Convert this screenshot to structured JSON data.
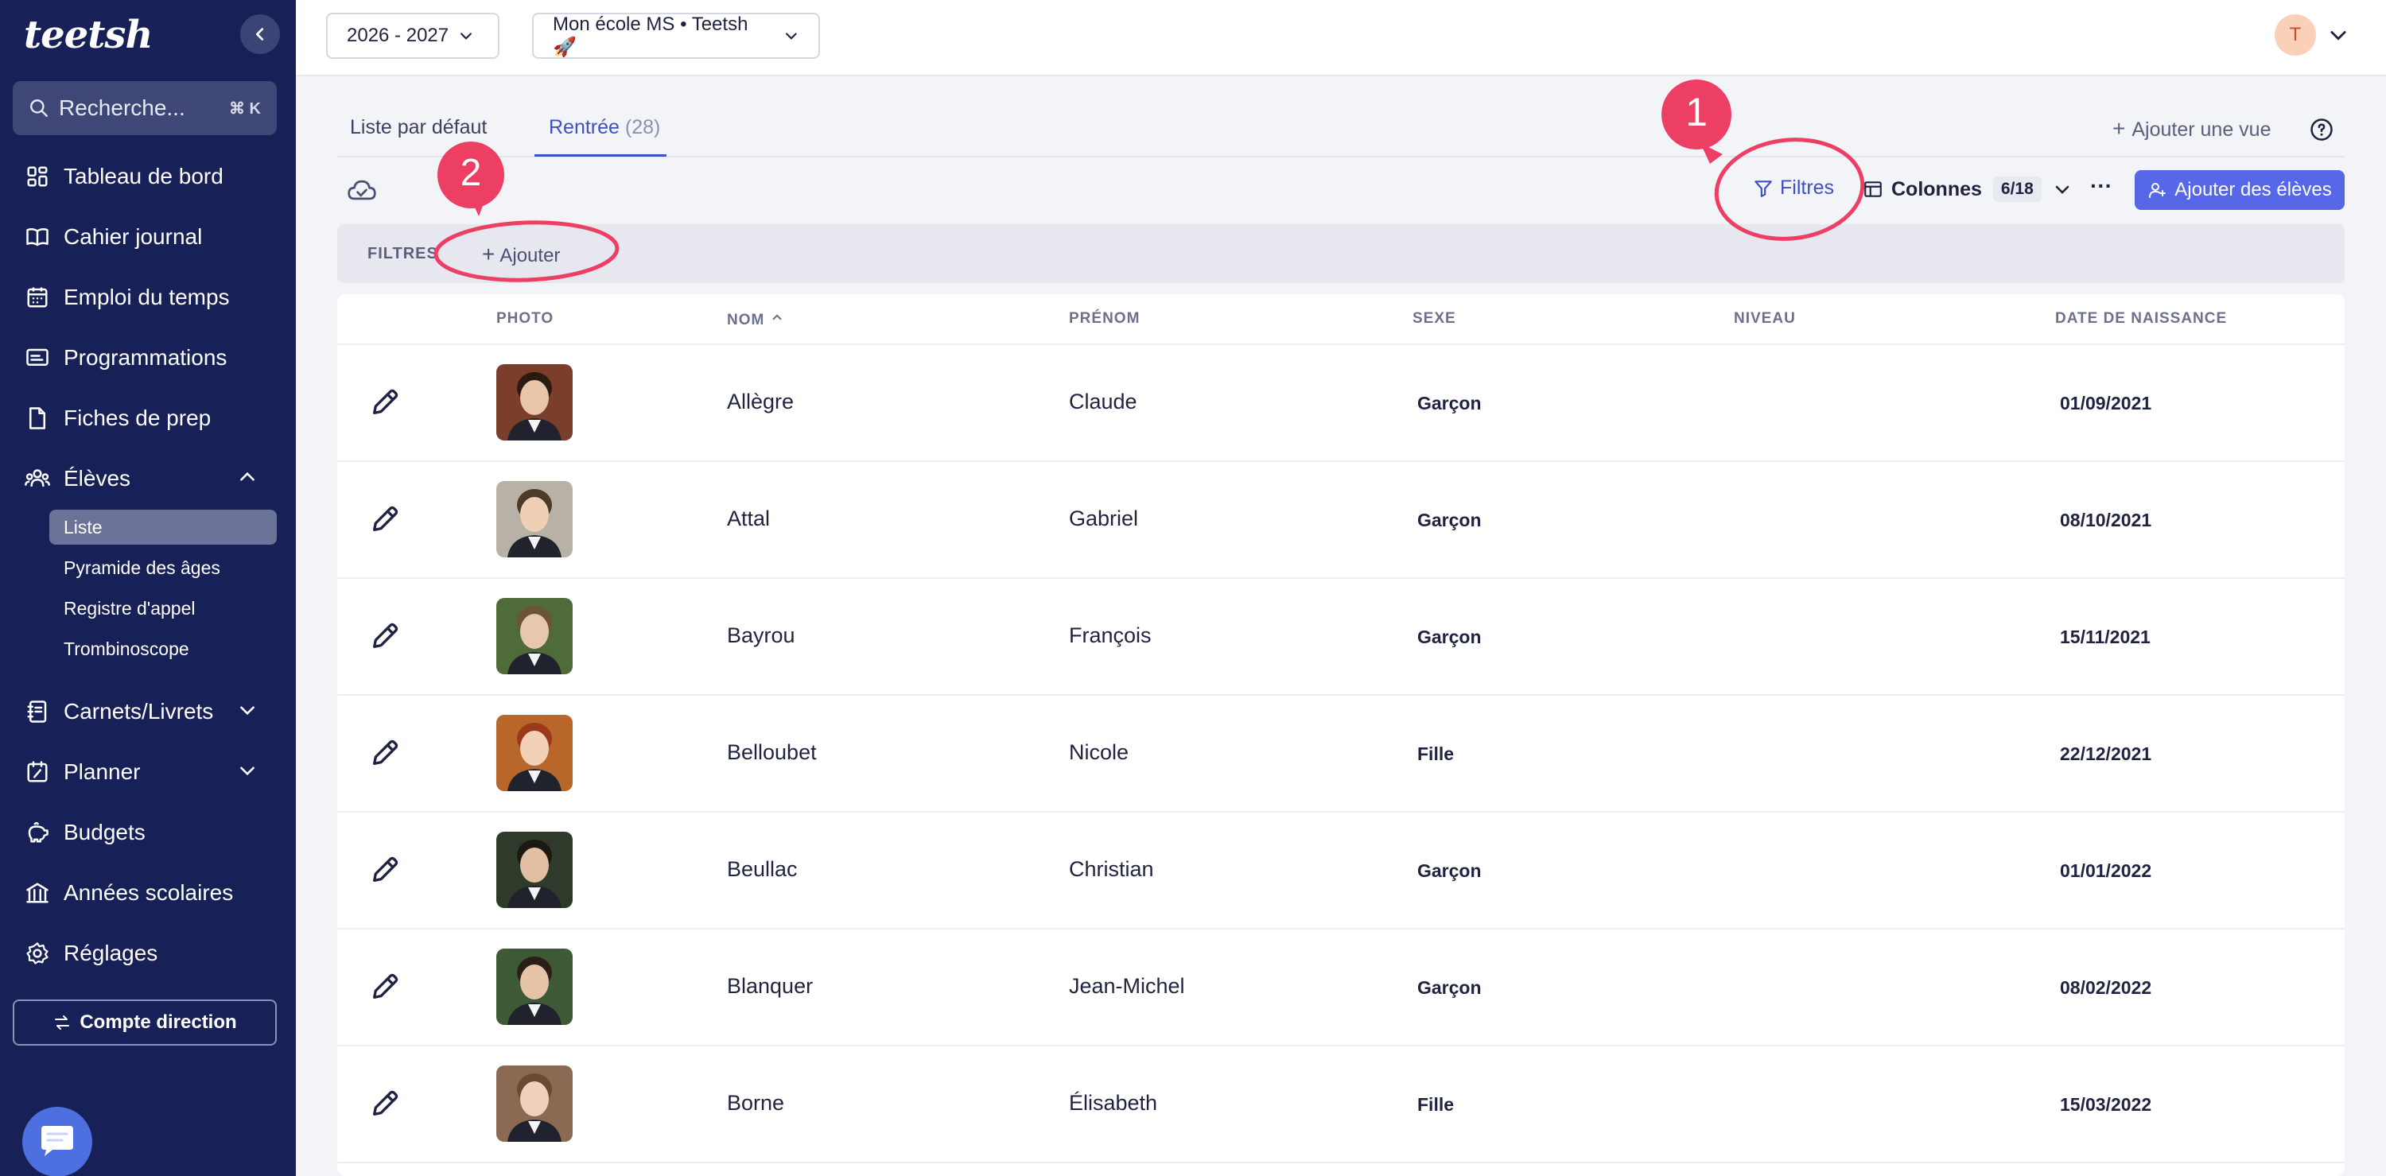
{
  "sidebar": {
    "logo": "teetsh",
    "search_placeholder": "Recherche...",
    "search_shortcut": "⌘ K",
    "items": [
      {
        "label": "Tableau de bord"
      },
      {
        "label": "Cahier journal"
      },
      {
        "label": "Emploi du temps"
      },
      {
        "label": "Programmations"
      },
      {
        "label": "Fiches de prep"
      },
      {
        "label": "Élèves"
      },
      {
        "label": "Carnets/Livrets"
      },
      {
        "label": "Planner"
      },
      {
        "label": "Budgets"
      },
      {
        "label": "Années scolaires"
      },
      {
        "label": "Réglages"
      }
    ],
    "sub_items": [
      {
        "label": "Liste",
        "active": true
      },
      {
        "label": "Pyramide des âges"
      },
      {
        "label": "Registre d'appel"
      },
      {
        "label": "Trombinoscope"
      }
    ],
    "account_button": "Compte direction"
  },
  "topbar": {
    "year": "2026 - 2027",
    "school": "Mon école MS • Teetsh 🚀",
    "avatar_initial": "T"
  },
  "tabs": [
    {
      "label": "Liste par défaut"
    },
    {
      "label": "Rentrée",
      "count": "(28)",
      "active": true
    }
  ],
  "add_view": "Ajouter une vue",
  "toolbar": {
    "filters": "Filtres",
    "columns": "Colonnes",
    "columns_badge": "6/18",
    "more": "···",
    "add_students": "Ajouter des élèves"
  },
  "filters_bar": {
    "label": "FILTRES",
    "add": "Ajouter"
  },
  "table": {
    "headers": [
      "PHOTO",
      "NOM",
      "PRÉNOM",
      "SEXE",
      "NIVEAU",
      "DATE DE NAISSANCE"
    ],
    "rows": [
      {
        "nom": "Allègre",
        "prenom": "Claude",
        "sexe": "Garçon",
        "niveau": "",
        "naissance": "01/09/2021"
      },
      {
        "nom": "Attal",
        "prenom": "Gabriel",
        "sexe": "Garçon",
        "niveau": "",
        "naissance": "08/10/2021"
      },
      {
        "nom": "Bayrou",
        "prenom": "François",
        "sexe": "Garçon",
        "niveau": "",
        "naissance": "15/11/2021"
      },
      {
        "nom": "Belloubet",
        "prenom": "Nicole",
        "sexe": "Fille",
        "niveau": "",
        "naissance": "22/12/2021"
      },
      {
        "nom": "Beullac",
        "prenom": "Christian",
        "sexe": "Garçon",
        "niveau": "",
        "naissance": "01/01/2022"
      },
      {
        "nom": "Blanquer",
        "prenom": "Jean-Michel",
        "sexe": "Garçon",
        "niveau": "",
        "naissance": "08/02/2022"
      },
      {
        "nom": "Borne",
        "prenom": "Élisabeth",
        "sexe": "Fille",
        "niveau": "",
        "naissance": "15/03/2022"
      }
    ]
  },
  "annotations": [
    {
      "number": "1"
    },
    {
      "number": "2"
    }
  ],
  "colors": {
    "sidebar": "#172157",
    "accent": "#3f4fc4",
    "primary_button": "#5668e8",
    "annotation": "#ec3f63"
  }
}
